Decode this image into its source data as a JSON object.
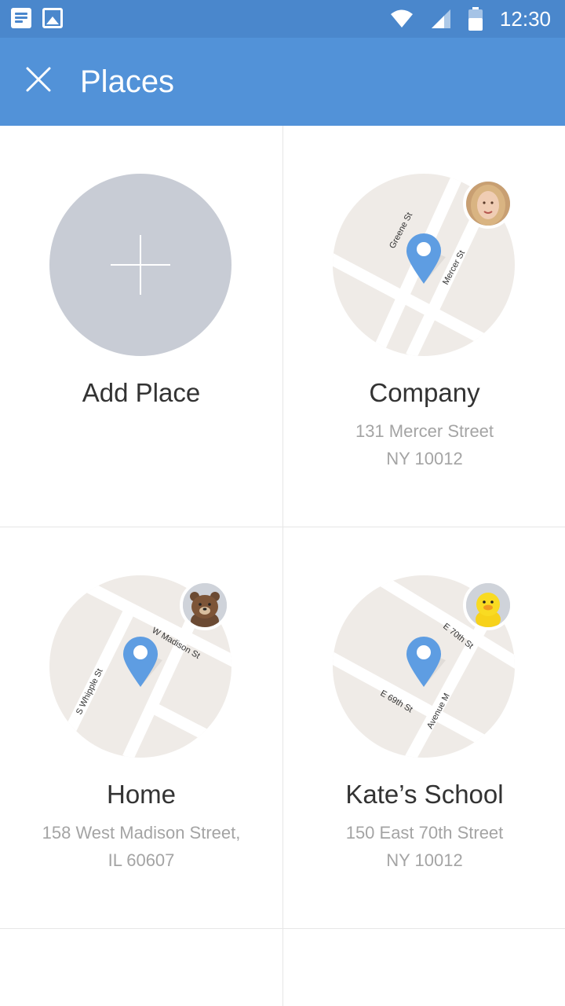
{
  "status_bar": {
    "time": "12:30",
    "icons": [
      "notes-icon",
      "image-icon",
      "wifi-icon",
      "signal-icon",
      "battery-icon"
    ]
  },
  "app_bar": {
    "title": "Places",
    "close_icon": "close-icon",
    "color": "#5292d8"
  },
  "add_place": {
    "label": "Add Place"
  },
  "places": [
    {
      "name": "Company",
      "line1": "131 Mercer Street",
      "line2": "NY 10012",
      "avatar": "woman-avatar",
      "streets": [
        "Greene St",
        "Mercer St"
      ]
    },
    {
      "name": "Home",
      "line1": "158 West Madison Street,",
      "line2": "IL 60607",
      "avatar": "bear-avatar",
      "streets": [
        "W Madison St",
        "S Whipple St"
      ]
    },
    {
      "name": "Kate’s School",
      "line1": "150 East 70th Street",
      "line2": "NY 10012",
      "avatar": "chick-avatar",
      "streets": [
        "E 70th St",
        "E 69th St",
        "Avenue M"
      ]
    }
  ],
  "colors": {
    "pin": "#5e9de2",
    "map_bg": "#efebe7",
    "add_circle": "#c8ccd5"
  }
}
